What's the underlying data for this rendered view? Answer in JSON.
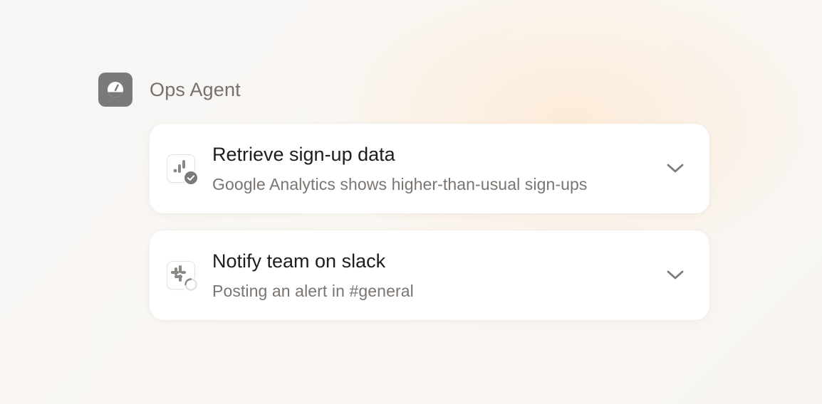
{
  "agent": {
    "name": "Ops Agent",
    "avatar_icon": "gauge-icon"
  },
  "tasks": [
    {
      "title": "Retrieve sign-up data",
      "subtitle": "Google Analytics shows higher-than-usual sign-ups",
      "tool_icon": "google-analytics-icon",
      "status": "complete",
      "status_icon": "check-circle-icon"
    },
    {
      "title": "Notify team on slack",
      "subtitle": "Posting an alert in #general",
      "tool_icon": "slack-icon",
      "status": "in-progress",
      "status_icon": "loading-spinner-icon"
    }
  ],
  "colors": {
    "avatar_bg": "#7b7a78",
    "title_text": "#1f1c19",
    "muted_text": "#7a7570",
    "card_bg": "#ffffff",
    "accent_glow": "#ffe2c4"
  }
}
